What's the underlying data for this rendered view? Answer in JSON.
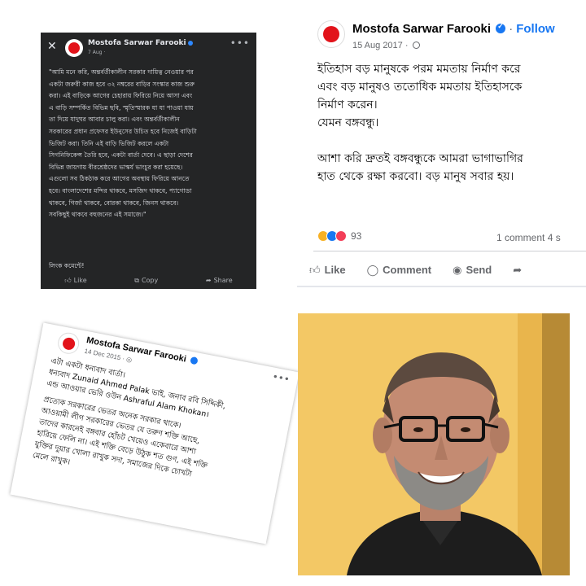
{
  "panel1": {
    "close_icon": "close-icon",
    "author": "Mostofa Sarwar Farooki",
    "date": "7 Aug ·",
    "more_icon": "more-dots-icon",
    "body_lines": [
      "\"আমি মনে করি, অন্তর্বর্তীকালীন সরকার দায়িত্ব নেওয়ার পর",
      "একটা জরুরী কাজ হবে ৩২ নম্বরের বাড়ির সংস্কার কাজ শুরু",
      "করা। এই বাড়িকে আগের চেহারায় ফিরিয়ে নিয়ে আসা এবং",
      "এ বাড়ি সম্পর্কিত বিভিন্ন ছবি, স্মৃতিস্মারক যা যা পাওয়া যায়",
      "তা দিয়ে যাদুঘর আবার চালু করা। এবং অন্তর্বর্তীকালীন",
      "সরকারের প্রধান প্রফেসর ইউনুসের উচিত হবে নিজেই বাড়িটা",
      "ভিজিট করা। তিনি এই বাড়ি ভিজিট করলে একটা",
      "সিগনিফিকেন্স তৈরি হবে, একটা বার্তা দেবে। এ ছাড়া দেশের",
      "বিভিন্ন জায়গায় বীরশ্রেষ্ঠদের ভাস্কর্য ভাংচুর করা হয়েছে।",
      "এগুলো সব ঠিকঠাক করে আগের অবস্থায় ফিরিয়ে আনতে",
      "হবে। বাংলাদেশের মন্দির থাকবে, মসজিদ থাকবে, প্যাগোডা",
      "থাকবে, গির্জা থাকবে, বোরকা থাকবে, জিনস থাকবে।",
      "সবকিছুই থাকবে বহুজনের এই সমাজে।\""
    ],
    "comment_link": "লিংক কমেন্টে!",
    "actions": {
      "like": "Like",
      "copy": "Copy",
      "share": "Share",
      "like_icon": "thumbs-up-icon",
      "copy_icon": "copy-icon",
      "share_icon": "share-arrow-icon"
    }
  },
  "panel2": {
    "author": "Mostofa Sarwar Farooki",
    "follow": "Follow",
    "date": "15 Aug 2017 ·",
    "body_lines_a": [
      "ইতিহাস বড় মানুষকে পরম মমতায় নির্মাণ করে",
      "এবং বড় মানুষও ততোধিক মমতায় ইতিহাসকে",
      "নির্মাণ করেন।",
      "যেমন বঙ্গবন্ধু।"
    ],
    "body_lines_b": [
      "আশা করি দ্রুতই বঙ্গবন্ধুকে আমরা ভাগাভাগির",
      "হাত থেকে রক্ষা করবো। বড় মানুষ সবার হয়।"
    ],
    "reaction_count": "93",
    "comments": "1 comment  4 s",
    "actions": {
      "like": "Like",
      "comment": "Comment",
      "send": "Send",
      "like_icon": "thumbs-up-icon",
      "comment_icon": "comment-bubble-icon",
      "send_icon": "messenger-icon",
      "share_icon": "share-arrow-icon"
    }
  },
  "panel3": {
    "author": "Mostofa Sarwar Farooki",
    "date": "14 Dec 2015 ·",
    "body_lines_a": [
      "এটা একটা ধন্যবাদ বার্তা।",
      "ধন্যবাদ Zunaid Ahmed Palak ভাই, জনাব রবি সিদ্দিকী,",
      "এন্ড আওয়ার ভেরি ওউন Ashraful Alam Khokan।"
    ],
    "body_lines_b": [
      "প্রত্যেক সরকারের ভেতর অনেক সরকার থাকে।",
      "আওয়ামী লীগ সরকারের ভেতর যে তরুণ শক্তি আছে,",
      "তাদের কারনেই বঙ্গবার হোঁচট খেয়েও একেবারে আশা",
      "হারিয়ে ফেলি না। এই শক্তি বেড়ে উঠুক শত গুণ, এই শক্তি",
      "যুক্তির দুয়ার খোলা রাখুক সদা, সমাজের দিকে চোখটা",
      "মেলে রাখুক।"
    ]
  },
  "panel4": {
    "photo": "portrait-photo"
  },
  "colors": {
    "dark_bg": "#242526",
    "brand_blue": "#1877f2",
    "avatar_red": "#e2131a",
    "photo_bg": "#f1c15a"
  }
}
